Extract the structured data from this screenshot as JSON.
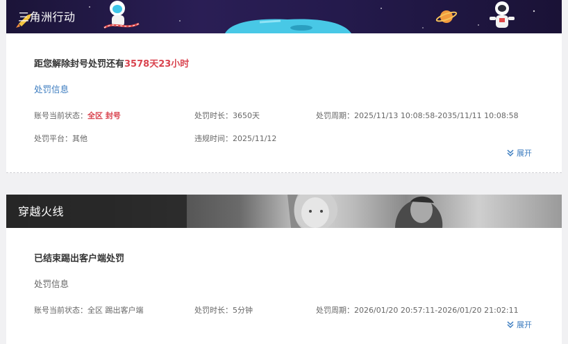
{
  "games": [
    {
      "name": "三角洲行动",
      "headline_prefix": "距您解除封号处罚还有",
      "headline_countdown": "3578天23小时",
      "info_label": "处罚信息",
      "status_label": "账号当前状态：",
      "status_value": "全区 封号",
      "duration": "处罚时长：3650天",
      "period": "处罚周期：2025/11/13 10:08:58-2035/11/11 10:08:58",
      "platform": "处罚平台：其他",
      "violation_time": "违规时间：2025/11/12",
      "expand_label": "展开"
    },
    {
      "name": "穿越火线",
      "headline": "已结束踢出客户端处罚",
      "info_label": "处罚信息",
      "status": "账号当前状态：全区 踢出客户端",
      "duration": "处罚时长：5分钟",
      "period": "处罚周期：2026/01/20 20:57:11-2026/01/20 21:02:11",
      "expand_label": "展开"
    }
  ],
  "colors": {
    "accent_red": "#d9444f",
    "link_blue": "#3a7bbf"
  },
  "icons": [
    "rocket-icon",
    "astronaut-icon",
    "planet-icon",
    "spaceship-icon",
    "chevron-double-down-icon"
  ]
}
